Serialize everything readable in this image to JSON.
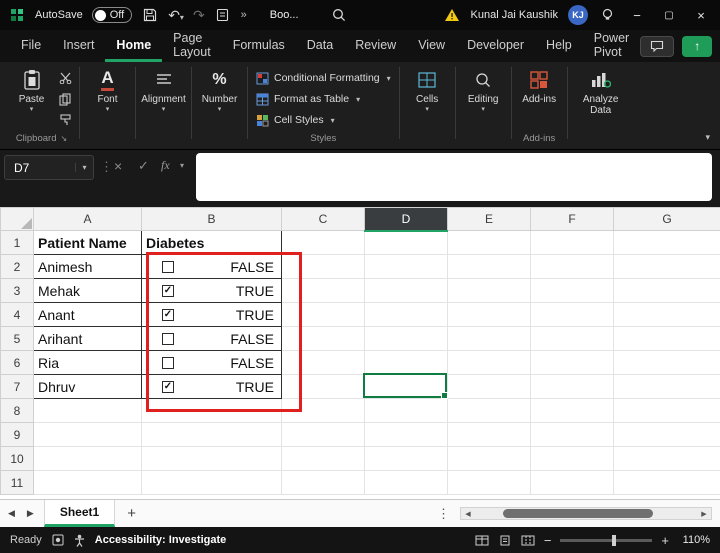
{
  "titlebar": {
    "autosave_label": "AutoSave",
    "autosave_state": "Off",
    "doc_name": "Boo...",
    "user_name": "Kunal Jai Kaushik",
    "avatar_initials": "KJ"
  },
  "menubar": {
    "tabs": [
      "File",
      "Insert",
      "Home",
      "Page Layout",
      "Formulas",
      "Data",
      "Review",
      "View",
      "Developer",
      "Help",
      "Power Pivot"
    ],
    "active_tab": "Home"
  },
  "ribbon": {
    "paste_label": "Paste",
    "clipboard_group_label": "Clipboard",
    "font_label": "Font",
    "alignment_label": "Alignment",
    "number_label": "Number",
    "conditional_formatting_label": "Conditional Formatting",
    "format_as_table_label": "Format as Table",
    "cell_styles_label": "Cell Styles",
    "styles_group_label": "Styles",
    "cells_label": "Cells",
    "editing_label": "Editing",
    "addins_label": "Add-ins",
    "addins_group_label": "Add-ins",
    "analyze_data_label": "Analyze Data"
  },
  "formula_bar": {
    "name_box": "D7",
    "fx_label": "fx",
    "content": ""
  },
  "sheet": {
    "col_headers": [
      "A",
      "B",
      "C",
      "D",
      "E",
      "F",
      "G"
    ],
    "row_headers": [
      "1",
      "2",
      "3",
      "4",
      "5",
      "6",
      "7",
      "8",
      "9",
      "10",
      "11"
    ],
    "header_row": {
      "a": "Patient Name",
      "b": "Diabetes"
    },
    "records": [
      {
        "name": "Animesh",
        "check": "",
        "value": "FALSE"
      },
      {
        "name": "Mehak",
        "check": "✓",
        "value": "TRUE"
      },
      {
        "name": "Anant",
        "check": "✓",
        "value": "TRUE"
      },
      {
        "name": "Arihant",
        "check": "",
        "value": "FALSE"
      },
      {
        "name": "Ria",
        "check": "",
        "value": "FALSE"
      },
      {
        "name": "Dhruv",
        "check": "✓",
        "value": "TRUE"
      }
    ],
    "selected_cell": "D7",
    "selected_column": "D"
  },
  "sheet_bar": {
    "tab_name": "Sheet1"
  },
  "status_bar": {
    "ready_label": "Ready",
    "accessibility_label": "Accessibility: Investigate",
    "zoom_level": "110%"
  },
  "colors": {
    "accent_green": "#21A366",
    "selection_green": "#107C41",
    "annotation_red": "#E0201F",
    "titlebar_bg": "#0A0A0A",
    "ribbon_bg": "#1E1E1E"
  }
}
